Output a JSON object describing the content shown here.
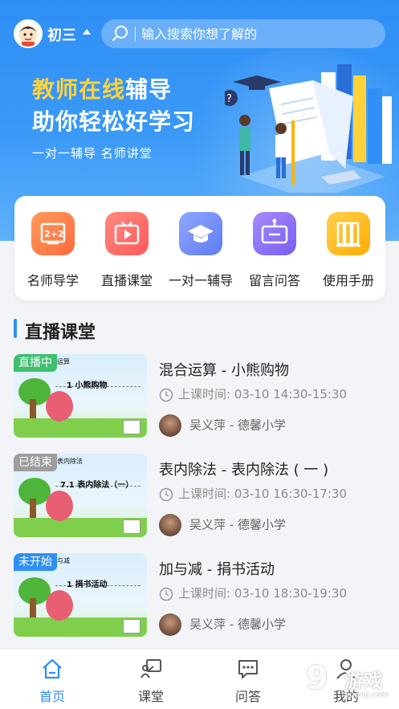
{
  "header": {
    "grade_label": "初三",
    "search_placeholder": "输入搜索你想了解的"
  },
  "banner": {
    "title_highlight": "教师在线",
    "title_rest": "辅导",
    "title_line2": "助你轻松好学习",
    "subtitle": "一对一辅导  名师讲堂"
  },
  "menu": {
    "items": [
      {
        "label": "名师导学",
        "icon": "blackboard-icon",
        "color": "#ff7a45"
      },
      {
        "label": "直播课堂",
        "icon": "video-play-icon",
        "color": "#ff6b6b"
      },
      {
        "label": "一对一辅导",
        "icon": "graduation-cap-icon",
        "color": "#6f8df7"
      },
      {
        "label": "留言问答",
        "icon": "message-board-icon",
        "color": "#8a6cf4"
      },
      {
        "label": "使用手册",
        "icon": "binders-icon",
        "color": "#ffb400"
      }
    ]
  },
  "live_section": {
    "title": "直播课堂",
    "courses": [
      {
        "status": "直播中",
        "status_color": "#3fbf6f",
        "thumb_small": "运算",
        "thumb_lesson": "1  小熊购物",
        "title": "混合运算 - 小熊购物",
        "time_label": "上课时间:",
        "time_value": "03-10 14:30-15:30",
        "teacher": "吴义萍 - 德馨小学"
      },
      {
        "status": "已结束",
        "status_color": "#9e9e9e",
        "thumb_small": "表内除法",
        "thumb_lesson": "7.1  表内除法（一）",
        "title": "表内除法 - 表内除法 ( 一 )",
        "time_label": "上课时间:",
        "time_value": "03-10 16:30-17:30",
        "teacher": "吴义萍 - 德馨小学"
      },
      {
        "status": "未开始",
        "status_color": "#2f8ff5",
        "thumb_small": "与减",
        "thumb_lesson": "1  捐书活动",
        "title": "加与减 - 捐书活动",
        "time_label": "上课时间:",
        "time_value": "03-10 18:30-19:30",
        "teacher": "吴义萍 - 德馨小学"
      }
    ]
  },
  "tabbar": {
    "tabs": [
      {
        "label": "首页",
        "icon": "home-icon",
        "active": true
      },
      {
        "label": "课堂",
        "icon": "classroom-icon",
        "active": false
      },
      {
        "label": "问答",
        "icon": "chat-icon",
        "active": false
      },
      {
        "label": "我的",
        "icon": "user-icon",
        "active": false
      }
    ]
  },
  "watermark": {
    "number": "9",
    "text": "游戏",
    "url": "9uanji.com"
  },
  "colors": {
    "primary": "#2f8ff5",
    "highlight": "#ffd23c"
  }
}
